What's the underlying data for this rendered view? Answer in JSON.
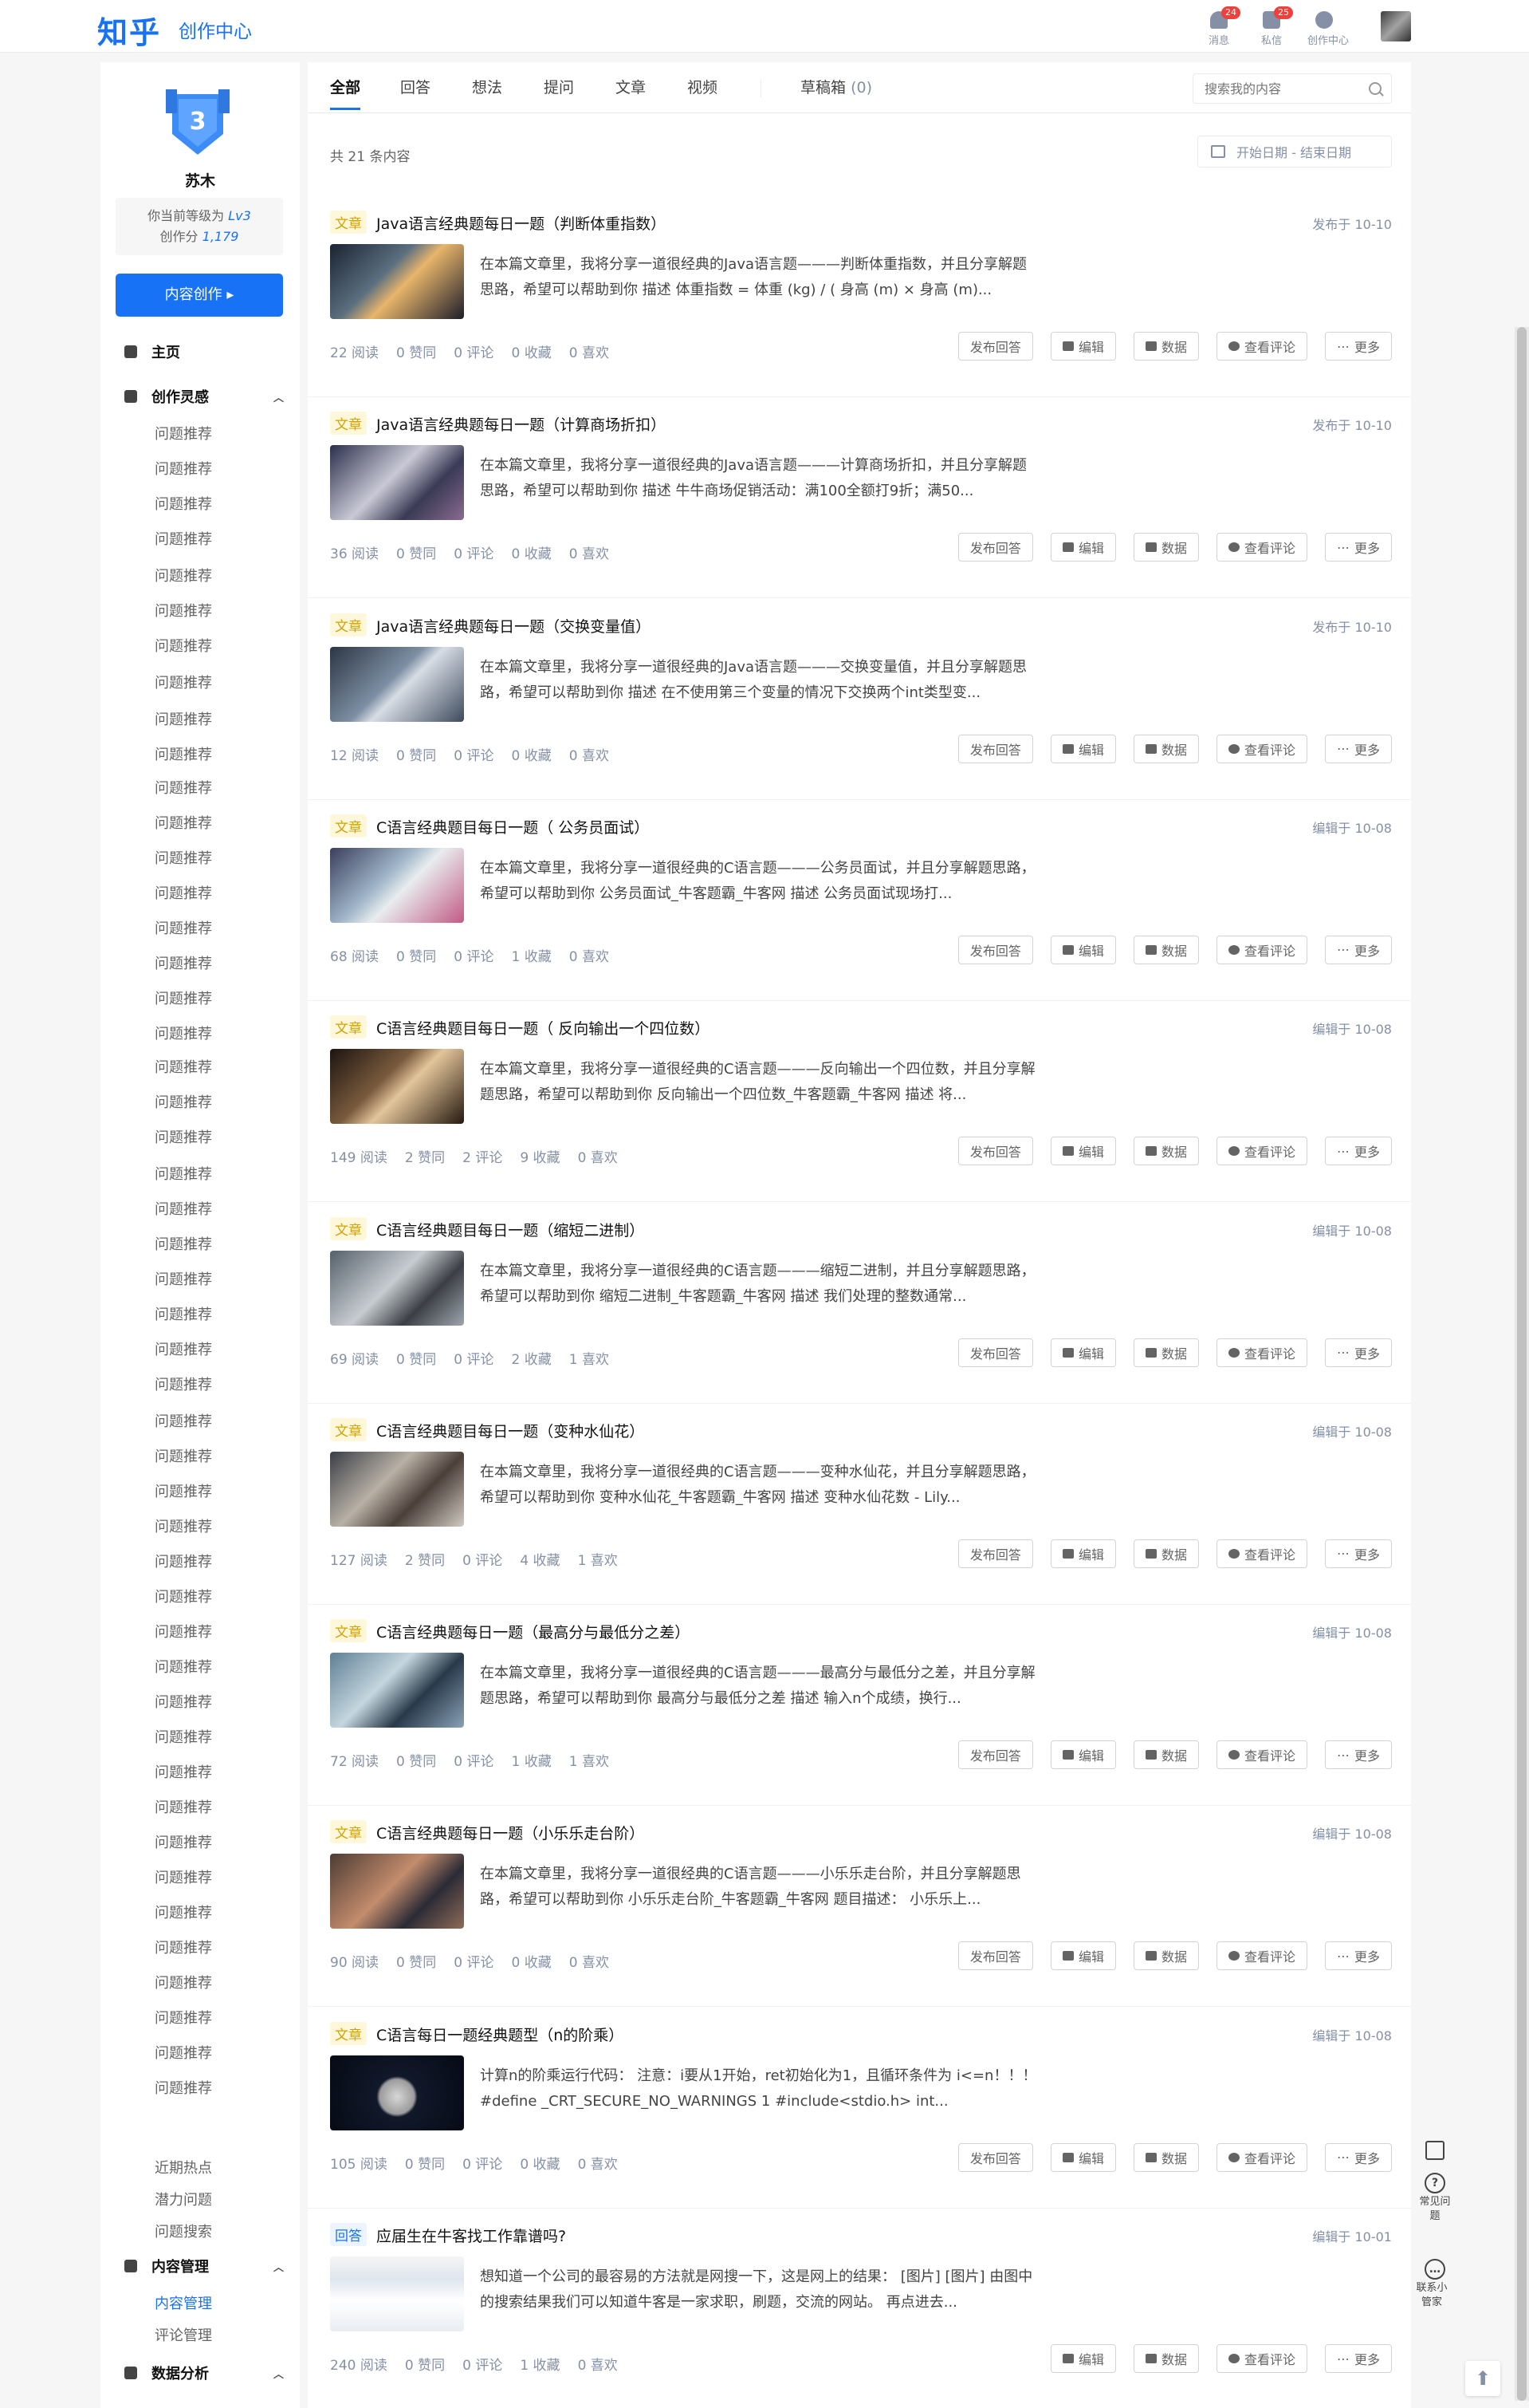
{
  "header": {
    "logo": "知乎",
    "subtitle": "创作中心",
    "icons": [
      {
        "label": "消息",
        "badge": "24",
        "icon": "bell-icon"
      },
      {
        "label": "私信",
        "badge": "25",
        "icon": "message-icon"
      },
      {
        "label": "创作中心",
        "badge": "",
        "icon": "creator-icon"
      }
    ]
  },
  "sidebar": {
    "level_number": "3",
    "user_name": "苏木",
    "level_text_prefix": "你当前等级为",
    "level_value": "Lv3",
    "score_prefix": "创作分",
    "score_value": "1,179",
    "create_button": "内容创作 ▸",
    "home": "主页",
    "inspiration": "创作灵感",
    "recommend": "问题推荐",
    "hot": "近期热点",
    "potential": "潜力问题",
    "search": "问题搜索",
    "content_mgmt": "内容管理",
    "content_items": [
      "内容管理",
      "评论管理"
    ],
    "data_analysis": "数据分析"
  },
  "tabs": {
    "items": [
      "全部",
      "回答",
      "想法",
      "提问",
      "文章",
      "视频"
    ],
    "drafts_label": "草稿箱",
    "drafts_count": "(0)",
    "search_placeholder": "搜索我的内容"
  },
  "summary": {
    "total": "共 21 条内容",
    "date_range": "开始日期 - 结束日期"
  },
  "buttons": {
    "publish_answer": "发布回答",
    "edit": "编辑",
    "data": "数据",
    "view_comments": "查看评论",
    "more": "更多"
  },
  "items": [
    {
      "tag": "文章",
      "title": "Java语言经典题每日一题（判断体重指数）",
      "date": "发布于 10-10",
      "excerpt": "在本篇文章里，我将分享一道很经典的Java语言题———判断体重指数，并且分享解题思路，希望可以帮助到你 描述 体重指数 = 体重 (kg) / ( 身高 (m) × 身高 (m)...",
      "reads": "22 阅读",
      "likes": "0 赞同",
      "comments": "0 评论",
      "saves": "0 收藏",
      "loves": "0 喜欢"
    },
    {
      "tag": "文章",
      "title": "Java语言经典题每日一题（计算商场折扣）",
      "date": "发布于 10-10",
      "excerpt": "在本篇文章里，我将分享一道很经典的Java语言题———计算商场折扣，并且分享解题思路，希望可以帮助到你 描述 牛牛商场促销活动：满100全额打9折；满50...",
      "reads": "36 阅读",
      "likes": "0 赞同",
      "comments": "0 评论",
      "saves": "0 收藏",
      "loves": "0 喜欢"
    },
    {
      "tag": "文章",
      "title": "Java语言经典题每日一题（交换变量值）",
      "date": "发布于 10-10",
      "excerpt": "在本篇文章里，我将分享一道很经典的Java语言题———交换变量值，并且分享解题思路，希望可以帮助到你 描述 在不使用第三个变量的情况下交换两个int类型变...",
      "reads": "12 阅读",
      "likes": "0 赞同",
      "comments": "0 评论",
      "saves": "0 收藏",
      "loves": "0 喜欢"
    },
    {
      "tag": "文章",
      "title": "C语言经典题目每日一题（ 公务员面试）",
      "date": "编辑于 10-08",
      "excerpt": "在本篇文章里，我将分享一道很经典的C语言题———公务员面试，并且分享解题思路，希望可以帮助到你 公务员面试_牛客题霸_牛客网 描述 公务员面试现场打...",
      "reads": "68 阅读",
      "likes": "0 赞同",
      "comments": "0 评论",
      "saves": "1 收藏",
      "loves": "0 喜欢"
    },
    {
      "tag": "文章",
      "title": "C语言经典题目每日一题（ 反向输出一个四位数）",
      "date": "编辑于 10-08",
      "excerpt": "在本篇文章里，我将分享一道很经典的C语言题———反向输出一个四位数，并且分享解题思路，希望可以帮助到你 反向输出一个四位数_牛客题霸_牛客网 描述 将...",
      "reads": "149 阅读",
      "likes": "2 赞同",
      "comments": "2 评论",
      "saves": "9 收藏",
      "loves": "0 喜欢"
    },
    {
      "tag": "文章",
      "title": "C语言经典题目每日一题（缩短二进制）",
      "date": "编辑于 10-08",
      "excerpt": "在本篇文章里，我将分享一道很经典的C语言题———缩短二进制，并且分享解题思路，希望可以帮助到你 缩短二进制_牛客题霸_牛客网 描述 我们处理的整数通常...",
      "reads": "69 阅读",
      "likes": "0 赞同",
      "comments": "0 评论",
      "saves": "2 收藏",
      "loves": "1 喜欢"
    },
    {
      "tag": "文章",
      "title": "C语言经典题目每日一题（变种水仙花）",
      "date": "编辑于 10-08",
      "excerpt": "在本篇文章里，我将分享一道很经典的C语言题———变种水仙花，并且分享解题思路，希望可以帮助到你 变种水仙花_牛客题霸_牛客网 描述 变种水仙花数 - Lily...",
      "reads": "127 阅读",
      "likes": "2 赞同",
      "comments": "0 评论",
      "saves": "4 收藏",
      "loves": "1 喜欢"
    },
    {
      "tag": "文章",
      "title": "C语言经典题每日一题（最高分与最低分之差）",
      "date": "编辑于 10-08",
      "excerpt": "在本篇文章里，我将分享一道很经典的C语言题———最高分与最低分之差，并且分享解题思路，希望可以帮助到你 最高分与最低分之差 描述 输入n个成绩，换行...",
      "reads": "72 阅读",
      "likes": "0 赞同",
      "comments": "0 评论",
      "saves": "1 收藏",
      "loves": "1 喜欢"
    },
    {
      "tag": "文章",
      "title": "C语言经典题每日一题（小乐乐走台阶）",
      "date": "编辑于 10-08",
      "excerpt": "在本篇文章里，我将分享一道很经典的C语言题———小乐乐走台阶，并且分享解题思路，希望可以帮助到你 小乐乐走台阶_牛客题霸_牛客网 题目描述： 小乐乐上...",
      "reads": "90 阅读",
      "likes": "0 赞同",
      "comments": "0 评论",
      "saves": "0 收藏",
      "loves": "0 喜欢"
    },
    {
      "tag": "文章",
      "title": "C语言每日一题经典题型（n的阶乘）",
      "date": "编辑于 10-08",
      "excerpt": "计算n的阶乘运行代码： 注意：i要从1开始，ret初始化为1，且循环条件为 i<=n！！！ #define _CRT_SECURE_NO_WARNINGS 1 #include<stdio.h> int...",
      "reads": "105 阅读",
      "likes": "0 赞同",
      "comments": "0 评论",
      "saves": "0 收藏",
      "loves": "0 喜欢"
    },
    {
      "tag": "回答",
      "title": "应届生在牛客找工作靠谱吗?",
      "date": "编辑于 10-01",
      "excerpt": "想知道一个公司的最容易的方法就是网搜一下，这是网上的结果： [图片] [图片] 由图中的搜索结果我们可以知道牛客是一家求职，刷题，交流的网站。 再点进去...",
      "reads": "240 阅读",
      "likes": "0 赞同",
      "comments": "0 评论",
      "saves": "1 收藏",
      "loves": "0 喜欢"
    }
  ],
  "rail": {
    "faq": "常见问题",
    "contact": "联系小管家"
  },
  "colors": {
    "brand": "#1772f6",
    "badge": "#f1403c",
    "tag_article": "#d5a100"
  }
}
